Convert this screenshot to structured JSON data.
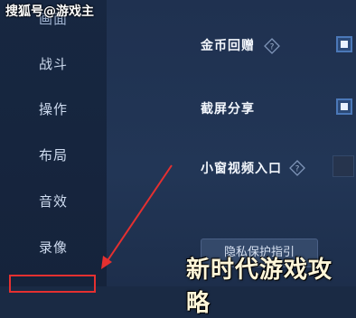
{
  "watermark": {
    "text": "搜狐号@游戏主"
  },
  "sidebar": {
    "items": [
      {
        "label": "画面",
        "partial": true
      },
      {
        "label": "战斗"
      },
      {
        "label": "操作"
      },
      {
        "label": "布局"
      },
      {
        "label": "音效"
      },
      {
        "label": "录像"
      }
    ]
  },
  "settings": {
    "items": [
      {
        "label": "金币回赠",
        "has_help": true,
        "checked": true
      },
      {
        "label": "截屏分享",
        "has_help": false,
        "checked": true
      },
      {
        "label": "小窗视频入口",
        "has_help": true,
        "checked": false
      }
    ],
    "privacy_button": "隐私保护指引"
  },
  "overlay": {
    "title": "新时代游戏攻略"
  },
  "colors": {
    "highlight": "#e53030",
    "arrow": "#e53030",
    "checkbox_on": "#2c4a78"
  }
}
